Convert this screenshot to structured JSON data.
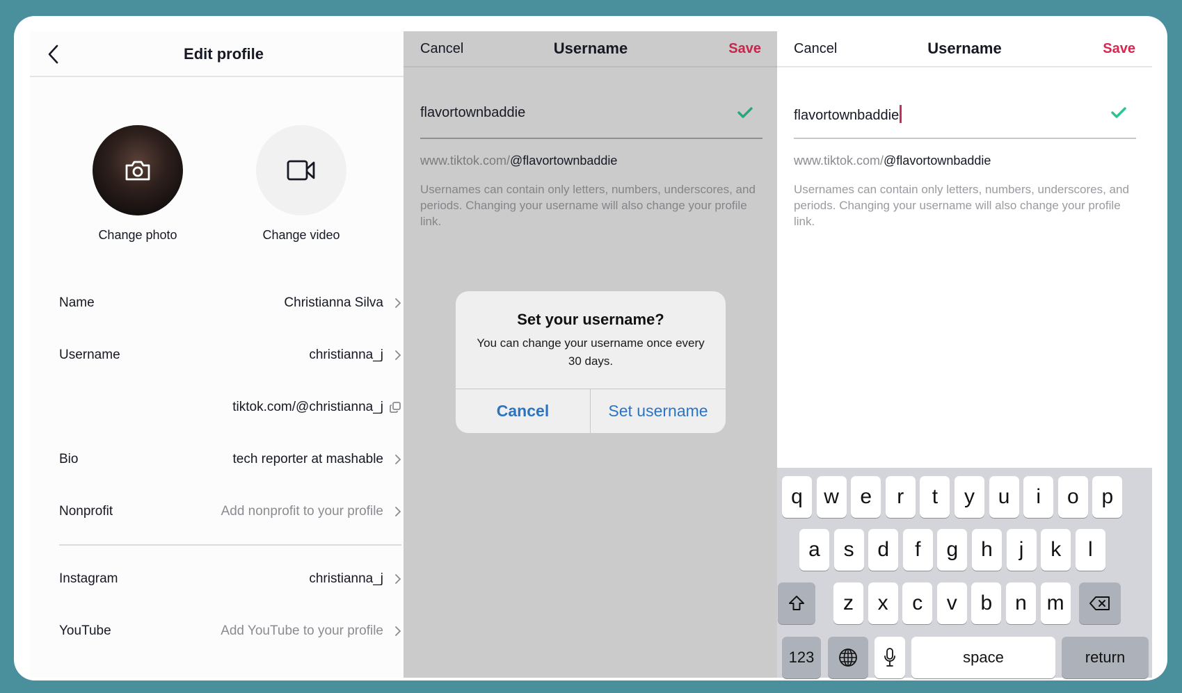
{
  "colors": {
    "frame": "#4a8f9c",
    "accent_red": "#d7264f",
    "check_green": "#2bc48e",
    "link_blue": "#2b74c4"
  },
  "edit_profile": {
    "title": "Edit profile",
    "back_icon": "chevron-left-icon",
    "change_photo_label": "Change photo",
    "change_video_label": "Change video",
    "rows": [
      {
        "label": "Name",
        "value": "Christianna Silva",
        "placeholder": false,
        "icon": "chevron-right-icon"
      },
      {
        "label": "Username",
        "value": "christianna_j",
        "placeholder": false,
        "icon": "chevron-right-icon"
      },
      {
        "label": "",
        "value": "tiktok.com/@christianna_j",
        "placeholder": false,
        "icon": "copy-icon"
      },
      {
        "label": "Bio",
        "value": "tech reporter at mashable",
        "placeholder": false,
        "icon": "chevron-right-icon"
      },
      {
        "label": "Nonprofit",
        "value": "Add nonprofit to your profile",
        "placeholder": true,
        "icon": "chevron-right-icon"
      },
      {
        "label": "Instagram",
        "value": "christianna_j",
        "placeholder": false,
        "icon": "chevron-right-icon"
      },
      {
        "label": "YouTube",
        "value": "Add YouTube to your profile",
        "placeholder": true,
        "icon": "chevron-right-icon"
      }
    ]
  },
  "username_screen_dialog": {
    "cancel": "Cancel",
    "title": "Username",
    "save": "Save",
    "field_value": "flavortownbaddie",
    "url_prefix": "www.tiktok.com/",
    "url_handle": "@flavortownbaddie",
    "help_text": "Usernames can contain only letters, numbers, underscores, and periods. Changing your username will also change your profile link.",
    "dialog": {
      "title": "Set your username?",
      "message": "You can change your username once every 30 days.",
      "cancel": "Cancel",
      "confirm": "Set username"
    }
  },
  "username_screen_keyboard": {
    "cancel": "Cancel",
    "title": "Username",
    "save": "Save",
    "field_value": "flavortownbaddie",
    "url_prefix": "www.tiktok.com/",
    "url_handle": "@flavortownbaddie",
    "help_text": "Usernames can contain only letters, numbers, underscores, and periods. Changing your username will also change your profile link.",
    "keyboard": {
      "row1": [
        "q",
        "w",
        "e",
        "r",
        "t",
        "y",
        "u",
        "i",
        "o",
        "p"
      ],
      "row2": [
        "a",
        "s",
        "d",
        "f",
        "g",
        "h",
        "j",
        "k",
        "l"
      ],
      "row3": [
        "z",
        "x",
        "c",
        "v",
        "b",
        "n",
        "m"
      ],
      "numbers": "123",
      "space": "space",
      "return": "return",
      "shift_icon": "shift-icon",
      "backspace_icon": "backspace-icon",
      "globe_icon": "globe-icon",
      "mic_icon": "microphone-icon"
    }
  }
}
